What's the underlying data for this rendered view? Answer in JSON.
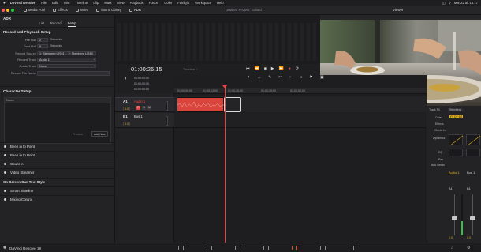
{
  "menubar": {
    "items": [
      "DaVinci Resolve",
      "File",
      "Edit",
      "Trim",
      "Timeline",
      "Clip",
      "Mark",
      "View",
      "Playback",
      "Fusion",
      "Color",
      "Fairlight",
      "Workspace",
      "Help"
    ],
    "clock": "Mar 22 alt 16:17"
  },
  "toolbar": {
    "media_pool": "Media Pool",
    "effects": "Effects",
    "index": "Index",
    "sound_library": "Sound Library",
    "adr": "ADR",
    "project_title": "Untitled Project",
    "edited": "Edited",
    "viewer_label": "Viewer"
  },
  "adr": {
    "title": "ADR",
    "tabs": [
      "List",
      "Record",
      "Setup"
    ],
    "active_tab": "Setup",
    "setup_title": "Record and Playback Setup",
    "pre_roll_label": "Pre Roll",
    "pre_roll_value": "2",
    "pre_roll_unit": "Seconds",
    "post_roll_label": "Post Roll",
    "post_roll_value": "0",
    "post_roll_unit": "Seconds",
    "record_source_label": "Record Source",
    "record_source_value": "1: Steinberg UR44 ... 2: Steinberg UR44",
    "record_track_label": "Record Track",
    "record_track_value": "Audio 1",
    "guide_track_label": "Guide Track",
    "guide_track_value": "None",
    "record_file_name_label": "Record File Name",
    "record_file_name_value": "",
    "character_setup": "Character Setup",
    "name_header": "Name",
    "preview_btn": "Preview",
    "add_new_btn": "Add New",
    "toggles": [
      "Beep in to Point",
      "Beep in to Point",
      "Count In",
      "Video Streamer"
    ],
    "cue_style": "On Screen Cue Text Style",
    "toggles2": [
      "Smart Timeline",
      "Mixing Control"
    ]
  },
  "timeline": {
    "timecode": "01:00:26:15",
    "timeline_name": "Timeline 1",
    "tc_rows": [
      "01:00:00:00",
      "01:00:00:00",
      "01:00:00:00"
    ],
    "ruler": [
      "01:00:00:00",
      "01:00:13:00",
      "01:00:26:00",
      "01:00:39:00",
      "01:00:52:00"
    ],
    "audio_track_num": "A1",
    "audio_track_name": "Audio 1",
    "audio_track_vol": "0.0",
    "bus_num": "B1",
    "bus_name": "Bus 1",
    "bus_vol": "0.0"
  },
  "mixer": {
    "track_fx": "Track FX",
    "input_label": "Input",
    "input_value": "Steinberg",
    "order_label": "Order",
    "order_value": "FX DY EQ",
    "effects_label": "Effects",
    "effects_in_label": "Effects In",
    "dynamics_label": "Dynamics",
    "eq_label": "EQ",
    "pan_label": "Pan",
    "bus_sends_label": "Bus Sends",
    "ch_audio": "Audio 1",
    "ch_bus": "Bus 1",
    "a1": "A1",
    "b1": "B1",
    "val1": "0.0",
    "val2": "0.0"
  },
  "bottom": {
    "app_name": "DaVinci Resolve 19"
  },
  "colors": {
    "accent_red": "#e5453d",
    "accent_yellow": "#e0b020",
    "playhead": "#e5453d"
  }
}
